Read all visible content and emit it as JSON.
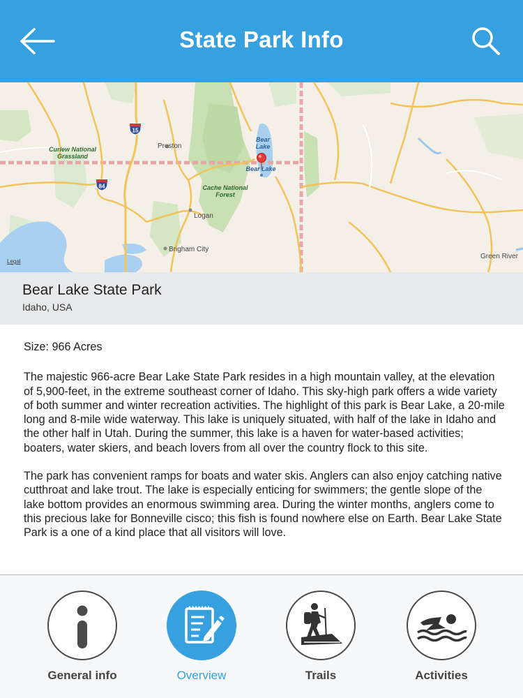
{
  "header": {
    "title": "State Park Info",
    "back_icon": "arrow-left-icon",
    "search_icon": "search-icon",
    "color": "#37a0de"
  },
  "map": {
    "labels": {
      "curlew": "Curlew National Grassland",
      "preston": "Preston",
      "bear_lake_water": "Bear Lake",
      "bear_lake_pin": "Bear Lake",
      "cache": "Cache National Forest",
      "logan": "Logan",
      "brigham": "Brigham City",
      "green_river": "Green River",
      "legal": "Legal",
      "i15": "15",
      "i84": "84"
    },
    "pin_icon": "map-pin-icon"
  },
  "park": {
    "name": "Bear Lake State Park",
    "location": "Idaho, USA"
  },
  "content": {
    "size": "Size: 966 Acres",
    "paragraph1": "The majestic 966-acre Bear Lake State Park resides in a high mountain valley, at the elevation of 5,900-feet, in the extreme southeast corner of Idaho. This sky-high park offers a wide variety of both summer and winter recreation activities. The highlight of this park is Bear Lake, a 20-mile long and 8-mile wide waterway. This lake is uniquely situated, with half of the lake in Idaho and the other half in Utah. During the summer, this lake is a haven for water-based activities; boaters, water skiers, and beach lovers from all over the country flock to this site.",
    "paragraph2": "The park has convenient ramps for boats and water skis. Anglers can also enjoy catching native cutthroat and lake trout. The lake is especially enticing for swimmers; the gentle slope of the lake bottom provides an enormous swimming area. During the winter months, anglers come to this precious lake for Bonneville cisco; this fish is found nowhere else on Earth. Bear Lake State Park is a one of a kind place that all visitors will love."
  },
  "tabs": [
    {
      "label": "General info",
      "icon": "info-icon",
      "active": false
    },
    {
      "label": "Overview",
      "icon": "notepad-icon",
      "active": true
    },
    {
      "label": "Trails",
      "icon": "hiker-icon",
      "active": false
    },
    {
      "label": "Activities",
      "icon": "swimmer-icon",
      "active": false
    }
  ]
}
